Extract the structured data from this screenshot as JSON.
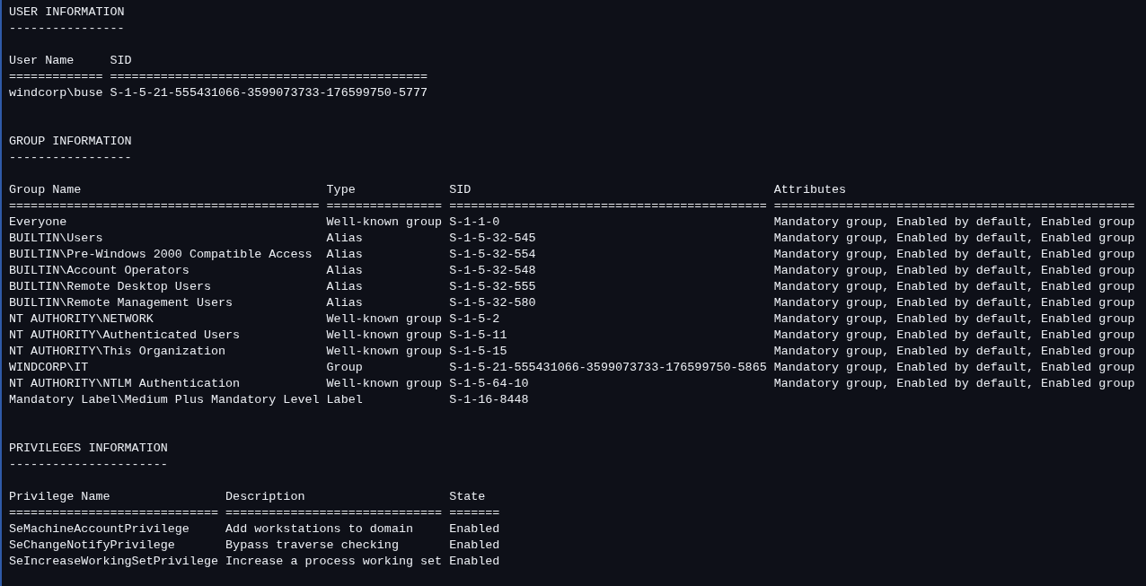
{
  "sections": [
    {
      "title": "USER INFORMATION",
      "underline": "----------------",
      "columns": [
        {
          "header": "User Name",
          "rule": "============="
        },
        {
          "header": "SID",
          "rule": "============================================"
        }
      ],
      "rows": [
        [
          "windcorp\\buse",
          "S-1-5-21-555431066-3599073733-176599750-5777"
        ]
      ]
    },
    {
      "title": "GROUP INFORMATION",
      "underline": "-----------------",
      "columns": [
        {
          "header": "Group Name",
          "rule": "==========================================="
        },
        {
          "header": "Type",
          "rule": "================"
        },
        {
          "header": "SID",
          "rule": "============================================"
        },
        {
          "header": "Attributes",
          "rule": "=================================================="
        }
      ],
      "rows": [
        [
          "Everyone",
          "Well-known group",
          "S-1-1-0",
          "Mandatory group, Enabled by default, Enabled group"
        ],
        [
          "BUILTIN\\Users",
          "Alias",
          "S-1-5-32-545",
          "Mandatory group, Enabled by default, Enabled group"
        ],
        [
          "BUILTIN\\Pre-Windows 2000 Compatible Access",
          "Alias",
          "S-1-5-32-554",
          "Mandatory group, Enabled by default, Enabled group"
        ],
        [
          "BUILTIN\\Account Operators",
          "Alias",
          "S-1-5-32-548",
          "Mandatory group, Enabled by default, Enabled group"
        ],
        [
          "BUILTIN\\Remote Desktop Users",
          "Alias",
          "S-1-5-32-555",
          "Mandatory group, Enabled by default, Enabled group"
        ],
        [
          "BUILTIN\\Remote Management Users",
          "Alias",
          "S-1-5-32-580",
          "Mandatory group, Enabled by default, Enabled group"
        ],
        [
          "NT AUTHORITY\\NETWORK",
          "Well-known group",
          "S-1-5-2",
          "Mandatory group, Enabled by default, Enabled group"
        ],
        [
          "NT AUTHORITY\\Authenticated Users",
          "Well-known group",
          "S-1-5-11",
          "Mandatory group, Enabled by default, Enabled group"
        ],
        [
          "NT AUTHORITY\\This Organization",
          "Well-known group",
          "S-1-5-15",
          "Mandatory group, Enabled by default, Enabled group"
        ],
        [
          "WINDCORP\\IT",
          "Group",
          "S-1-5-21-555431066-3599073733-176599750-5865",
          "Mandatory group, Enabled by default, Enabled group"
        ],
        [
          "NT AUTHORITY\\NTLM Authentication",
          "Well-known group",
          "S-1-5-64-10",
          "Mandatory group, Enabled by default, Enabled group"
        ],
        [
          "Mandatory Label\\Medium Plus Mandatory Level",
          "Label",
          "S-1-16-8448"
        ]
      ]
    },
    {
      "title": "PRIVILEGES INFORMATION",
      "underline": "----------------------",
      "columns": [
        {
          "header": "Privilege Name",
          "rule": "============================="
        },
        {
          "header": "Description",
          "rule": "=============================="
        },
        {
          "header": "State",
          "rule": "======="
        }
      ],
      "rows": [
        [
          "SeMachineAccountPrivilege",
          "Add workstations to domain",
          "Enabled"
        ],
        [
          "SeChangeNotifyPrivilege",
          "Bypass traverse checking",
          "Enabled"
        ],
        [
          "SeIncreaseWorkingSetPrivilege",
          "Increase a process working set",
          "Enabled"
        ]
      ]
    }
  ]
}
